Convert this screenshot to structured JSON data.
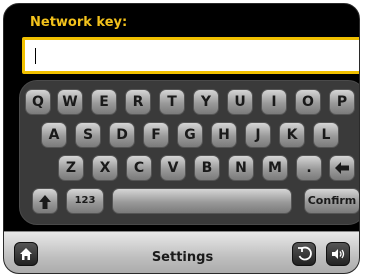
{
  "input": {
    "label": "Network key:",
    "value": ""
  },
  "keyboard": {
    "row1": [
      "Q",
      "W",
      "E",
      "R",
      "T",
      "Y",
      "U",
      "I",
      "O",
      "P"
    ],
    "row2": [
      "A",
      "S",
      "D",
      "F",
      "G",
      "H",
      "J",
      "K",
      "L"
    ],
    "row3": [
      "Z",
      "X",
      "C",
      "V",
      "B",
      "N",
      "M",
      "."
    ],
    "numbers_key": "123",
    "confirm_key": "Confirm",
    "icons": {
      "backspace": "left-arrow-icon",
      "shift": "up-arrow-icon"
    }
  },
  "bottom_bar": {
    "title": "Settings",
    "icons": [
      "home-icon",
      "back-icon",
      "volume-icon"
    ]
  },
  "colors": {
    "label": "#f3c21c",
    "input_border": "#f0c000",
    "background": "#000000",
    "key_text": "#1a1a1a"
  }
}
